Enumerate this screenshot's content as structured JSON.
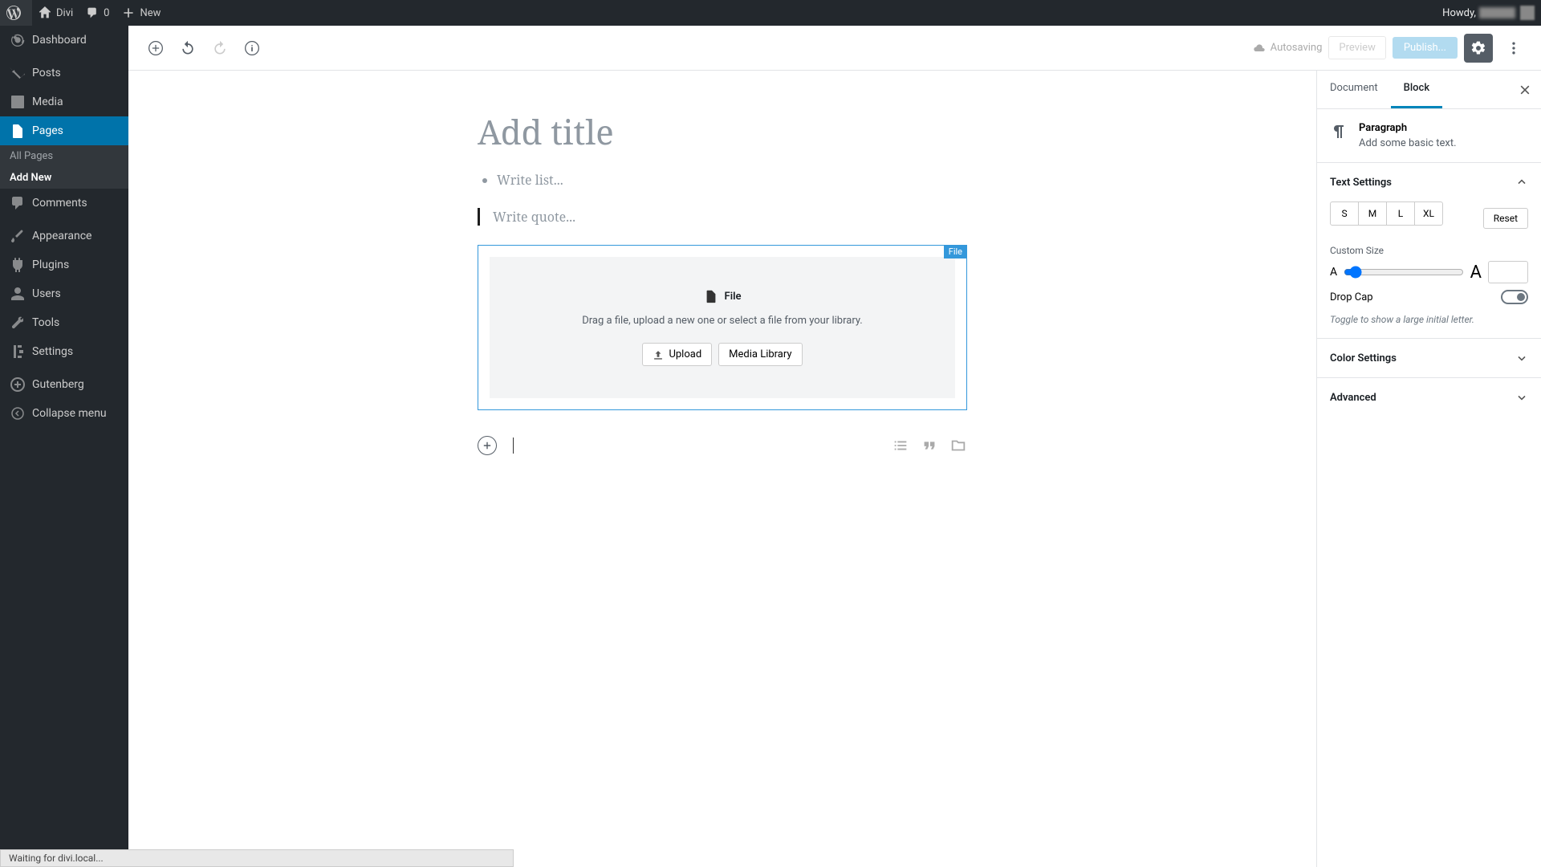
{
  "adminBar": {
    "site": "Divi",
    "comments": "0",
    "new": "New",
    "howdy": "Howdy,"
  },
  "sidebar": {
    "dashboard": "Dashboard",
    "posts": "Posts",
    "media": "Media",
    "pages": "Pages",
    "allPages": "All Pages",
    "addNew": "Add New",
    "comments": "Comments",
    "appearance": "Appearance",
    "plugins": "Plugins",
    "users": "Users",
    "tools": "Tools",
    "settings": "Settings",
    "gutenberg": "Gutenberg",
    "collapse": "Collapse menu"
  },
  "header": {
    "autosaving": "Autosaving",
    "preview": "Preview",
    "publish": "Publish..."
  },
  "editor": {
    "titlePlaceholder": "Add title",
    "listPlaceholder": "Write list...",
    "quotePlaceholder": "Write quote...",
    "fileTag": "File",
    "fileTitle": "File",
    "fileDesc": "Drag a file, upload a new one or select a file from your library.",
    "upload": "Upload",
    "mediaLibrary": "Media Library"
  },
  "settings": {
    "documentTab": "Document",
    "blockTab": "Block",
    "blockName": "Paragraph",
    "blockDesc": "Add some basic text.",
    "textSettings": "Text Settings",
    "sizeS": "S",
    "sizeM": "M",
    "sizeL": "L",
    "sizeXL": "XL",
    "reset": "Reset",
    "customSize": "Custom Size",
    "dropCap": "Drop Cap",
    "dropCapHint": "Toggle to show a large initial letter.",
    "colorSettings": "Color Settings",
    "advanced": "Advanced"
  },
  "status": "Waiting for divi.local..."
}
